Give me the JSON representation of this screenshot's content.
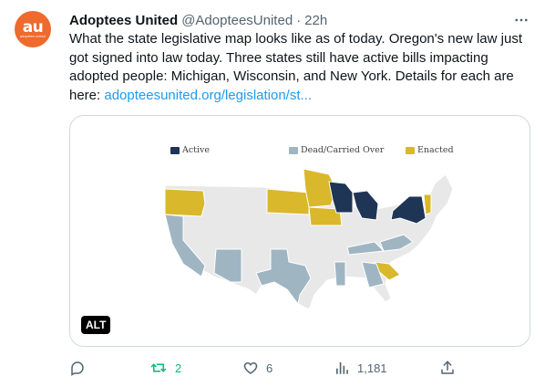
{
  "author": {
    "display_name": "Adoptees United",
    "handle": "@AdopteesUnited",
    "separator": "·",
    "time": "22h",
    "avatar": {
      "logo_text": "au",
      "logo_subtext": "adoptees united",
      "bg_color": "#ee6a2d"
    }
  },
  "more_icon": "more-horizontal-icon",
  "tweet": {
    "text": "What the state legislative map looks like as of today. Oregon's new law just got signed into law today. Three states still have active bills impacting adopted people: Michigan, Wisconsin, and New York. Details for each are here: ",
    "link_text": "adopteesunited.org/legislation/st..."
  },
  "media": {
    "alt_label": "ALT",
    "legend": [
      {
        "label": "Active",
        "color": "#1f3556"
      },
      {
        "label": "Dead/Carried Over",
        "color": "#9fb5c2"
      },
      {
        "label": "Enacted",
        "color": "#d9b82b"
      }
    ],
    "map_colors": {
      "base": "#e8e8e8",
      "active": "#1f3556",
      "dead": "#9fb5c2",
      "enacted": "#d9b82b"
    }
  },
  "actions": {
    "reply": {
      "icon": "reply-icon",
      "count": ""
    },
    "retweet": {
      "icon": "retweet-icon",
      "count": "2",
      "color": "#00ba7c"
    },
    "like": {
      "icon": "heart-icon",
      "count": "6"
    },
    "views": {
      "icon": "views-chart-icon",
      "count": "1,181"
    },
    "share": {
      "icon": "share-icon",
      "count": ""
    }
  }
}
